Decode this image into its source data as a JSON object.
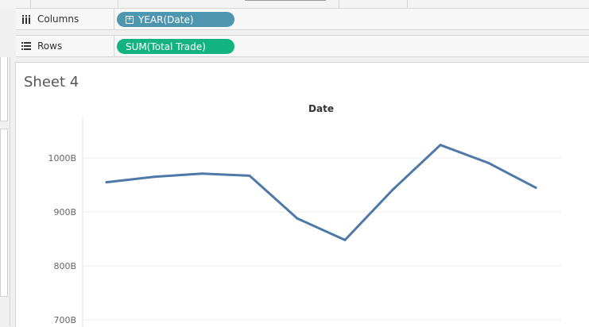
{
  "shelves": {
    "columns": {
      "label": "Columns",
      "icon": "columns-icon",
      "pill": "YEAR(Date)",
      "pill_color": "#4e95b0"
    },
    "rows": {
      "label": "Rows",
      "icon": "rows-icon",
      "pill": "SUM(Total Trade)",
      "pill_color": "#12b37f"
    }
  },
  "sheet": {
    "title": "Sheet 4"
  },
  "chart_data": {
    "type": "line",
    "title": "Date",
    "series": [
      {
        "values": [
          955,
          965,
          971,
          967,
          888,
          848,
          941,
          1024,
          991,
          945
        ],
        "color": "#4e79a7"
      }
    ],
    "yticks": [
      {
        "value": 1000,
        "label": "1000B"
      },
      {
        "value": 900,
        "label": "900B"
      },
      {
        "value": 800,
        "label": "800B"
      },
      {
        "value": 700,
        "label": "700B"
      }
    ],
    "grid": true
  }
}
